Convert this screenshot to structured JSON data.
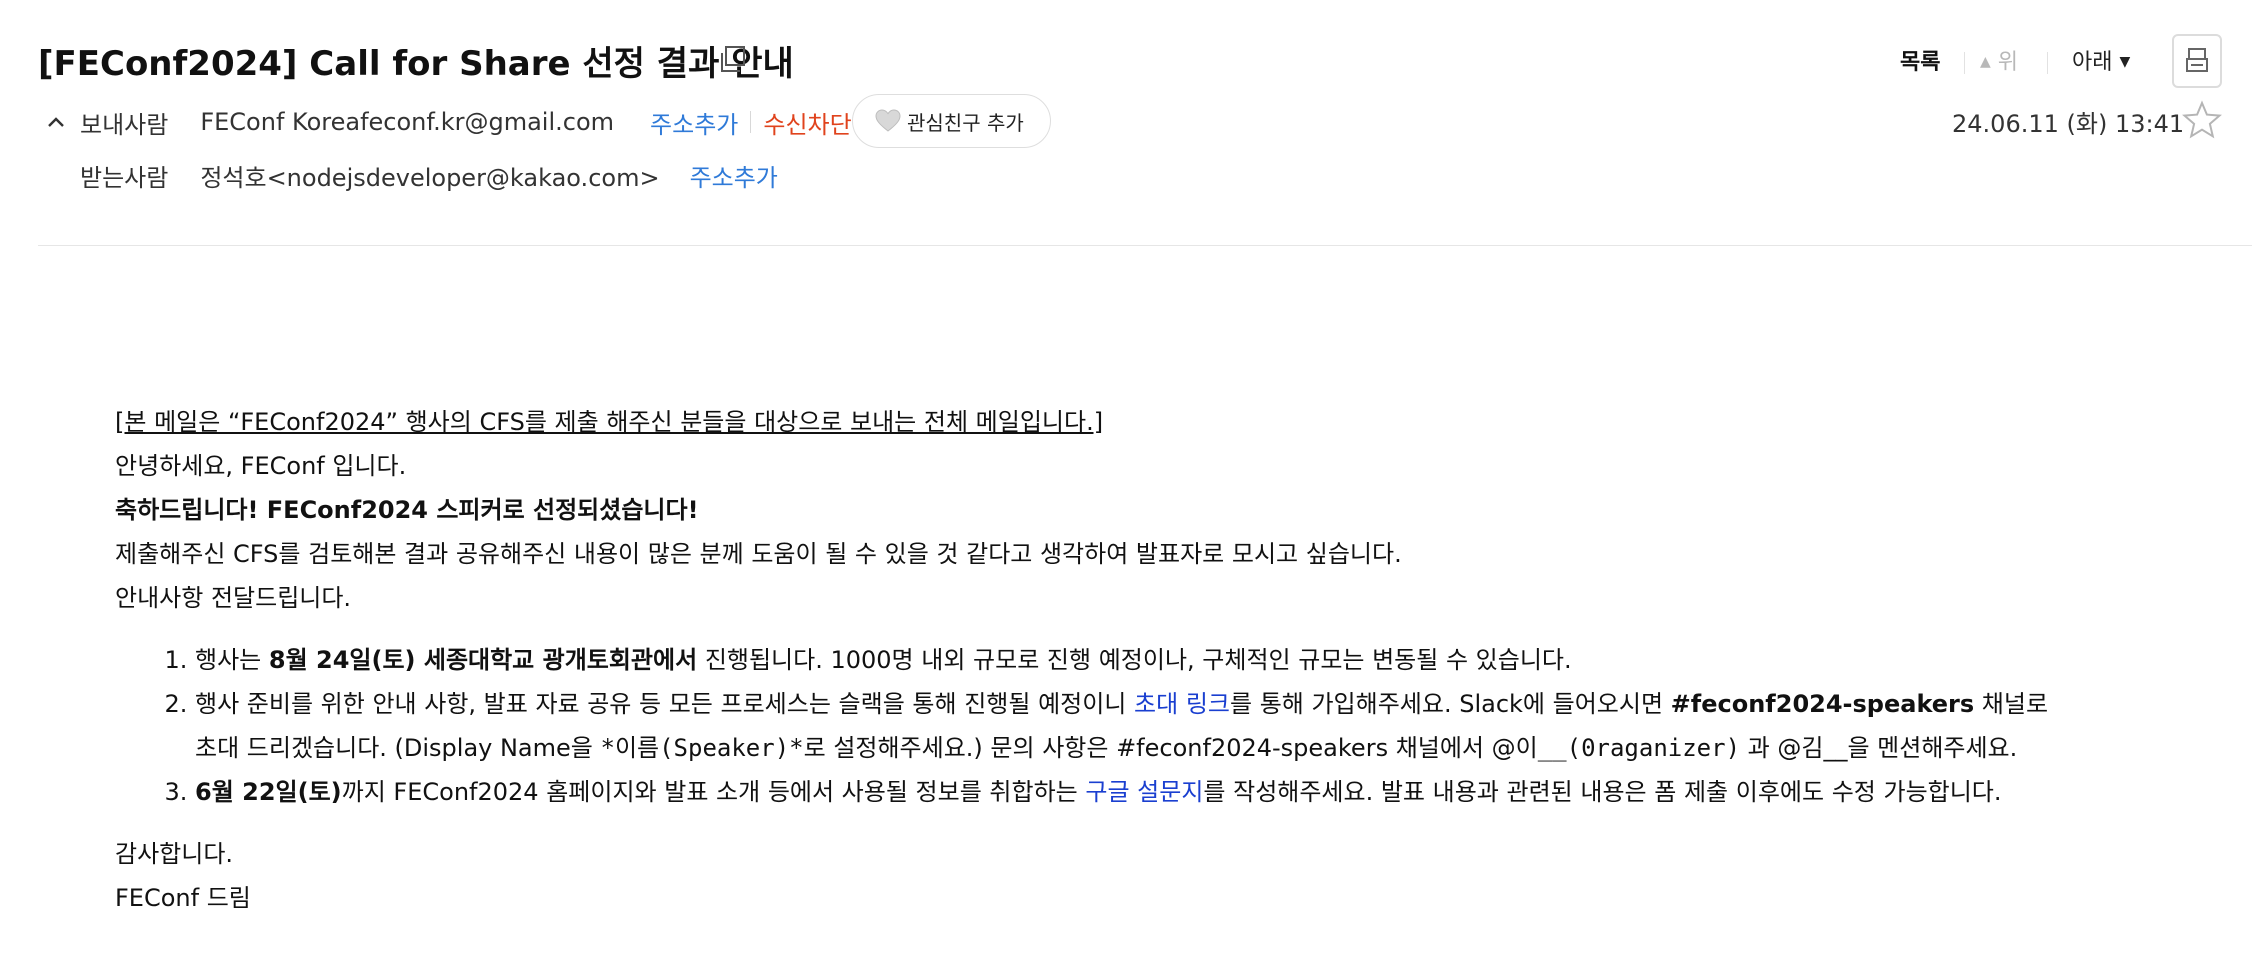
{
  "header": {
    "subject": "[FEConf2024] Call for Share 선정 결과 안내",
    "toolbar": {
      "list": "목록",
      "up": "위",
      "down": "아래"
    }
  },
  "sender": {
    "label": "보내사람",
    "name": "FEConf Korea",
    "email": "feconf.kr@gmail.com",
    "add_address": "주소추가",
    "block": "수신차단",
    "favorite": "관심친구 추가"
  },
  "recipient": {
    "label": "받는사람",
    "value": "정석호<nodejsdeveloper@kakao.com>",
    "add_address": "주소추가"
  },
  "date": "24.06.11 (화) 13:41",
  "body": {
    "notice": "[본 메일은 “FEConf2024” 행사의 CFS를 제출 해주신 분들을 대상으로 보내는 전체 메일입니다.]",
    "greeting": "안녕하세요, FEConf 입니다.",
    "congrats": "축하드립니다! FEConf2024 스피커로 선정되셨습니다!",
    "intro": "제출해주신 CFS를 검토해본 결과 공유해주신 내용이 많은 분께 도움이 될 수 있을 것 같다고 생각하여 발표자로 모시고 싶습니다.",
    "info": "안내사항 전달드립니다.",
    "item1": {
      "pre": "행사는 ",
      "bold": "8월 24일(토) 세종대학교 광개토회관에서",
      "post": " 진행됩니다. 1000명 내외 규모로 진행 예정이나, 구체적인 규모는 변동될 수 있습니다."
    },
    "item2": {
      "pre": "행사 준비를 위한 안내 사항, 발표 자료 공유 등 모든 프로세스는 슬랙을 통해 진행될 예정이니 ",
      "link": "초대 링크",
      "mid": "를 통해 가입해주세요. Slack에 들어오시면 ",
      "bold": "#feconf2024-speakers",
      "post": " 채널로",
      "line2_a": "초대 드리겠습니다. (Display Name을 ",
      "line2_code": "*이름(Speaker)*",
      "line2_b": "로 설정해주세요.) 문의 사항은 #feconf2024-speakers 채널에서 @이",
      "line2_code2": "__(0raganizer)",
      "line2_c": " 과 @김__을 멘션해주세요."
    },
    "item3": {
      "bold": "6월 22일(토)",
      "pre": "까지 FEConf2024 홈페이지와 발표 소개 등에서 사용될 정보를 취합하는 ",
      "link": "구글 설문지",
      "post": "를 작성해주세요. 발표 내용과 관련된 내용은 폼 제출 이후에도 수정 가능합니다."
    },
    "thanks": "감사합니다.",
    "sign": "FEConf 드림"
  }
}
